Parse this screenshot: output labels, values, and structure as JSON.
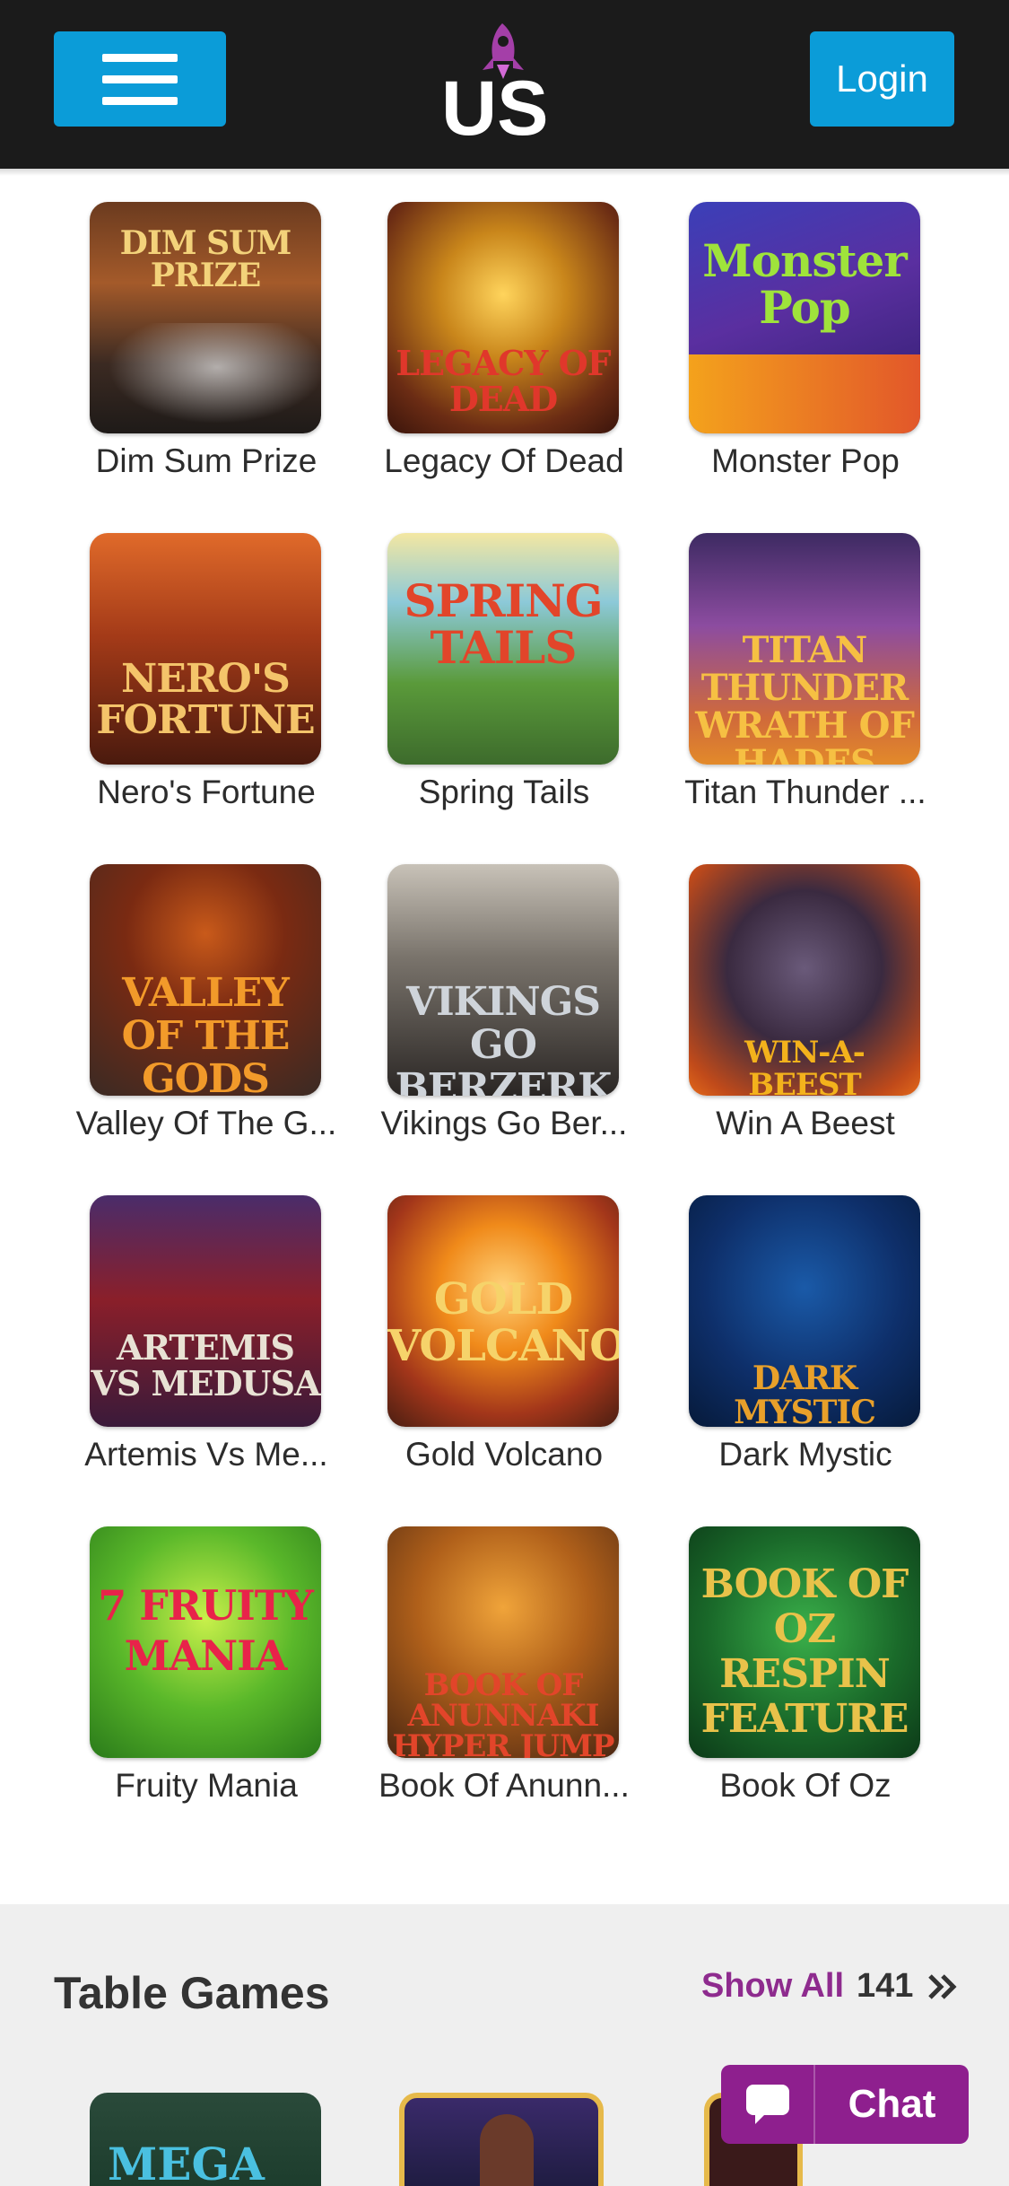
{
  "header": {
    "menu_icon": "hamburger-icon",
    "logo_text": "US",
    "login_label": "Login",
    "accent_color": "#0b9cd8"
  },
  "games": [
    {
      "name": "Dim Sum Prize",
      "art_text": "DIM SUM PRIZE"
    },
    {
      "name": "Legacy Of Dead",
      "art_text": "LEGACY OF DEAD"
    },
    {
      "name": "Monster Pop",
      "art_text": "Monster Pop"
    },
    {
      "name": "Nero's Fortune",
      "art_text": "NERO'S FORTUNE"
    },
    {
      "name": "Spring Tails",
      "art_text": "SPRING TAILS"
    },
    {
      "name": "Titan Thunder ...",
      "art_text": "TITAN THUNDER WRATH OF HADES"
    },
    {
      "name": "Valley Of The G...",
      "art_text": "VALLEY OF THE GODS"
    },
    {
      "name": "Vikings Go Ber...",
      "art_text": "VIKINGS GO BERZERK"
    },
    {
      "name": "Win A Beest",
      "art_text": "WIN-A-BEEST"
    },
    {
      "name": "Artemis Vs Me...",
      "art_text": "ARTEMIS VS MEDUSA"
    },
    {
      "name": "Gold Volcano",
      "art_text": "GOLD VOLCANO"
    },
    {
      "name": "Dark Mystic",
      "art_text": "DARK MYSTIC"
    },
    {
      "name": "Fruity Mania",
      "art_text": "7 FRUITY MANIA"
    },
    {
      "name": "Book Of Anunn...",
      "art_text": "BOOK OF ANUNNAKI HYPER JUMP"
    },
    {
      "name": "Book Of Oz",
      "art_text": "BOOK OF OZ RESPIN FEATURE"
    }
  ],
  "table_games": {
    "title": "Table Games",
    "show_all_label": "Show All",
    "count": "141",
    "arrow_icon": "double-chevron-right-icon",
    "thumbs": [
      {
        "art_text": "MEGA"
      },
      {
        "art_text": ""
      },
      {
        "art_text": ""
      }
    ]
  },
  "chat": {
    "label": "Chat",
    "icon": "speech-bubble-icon",
    "color": "#8e1f8e"
  }
}
